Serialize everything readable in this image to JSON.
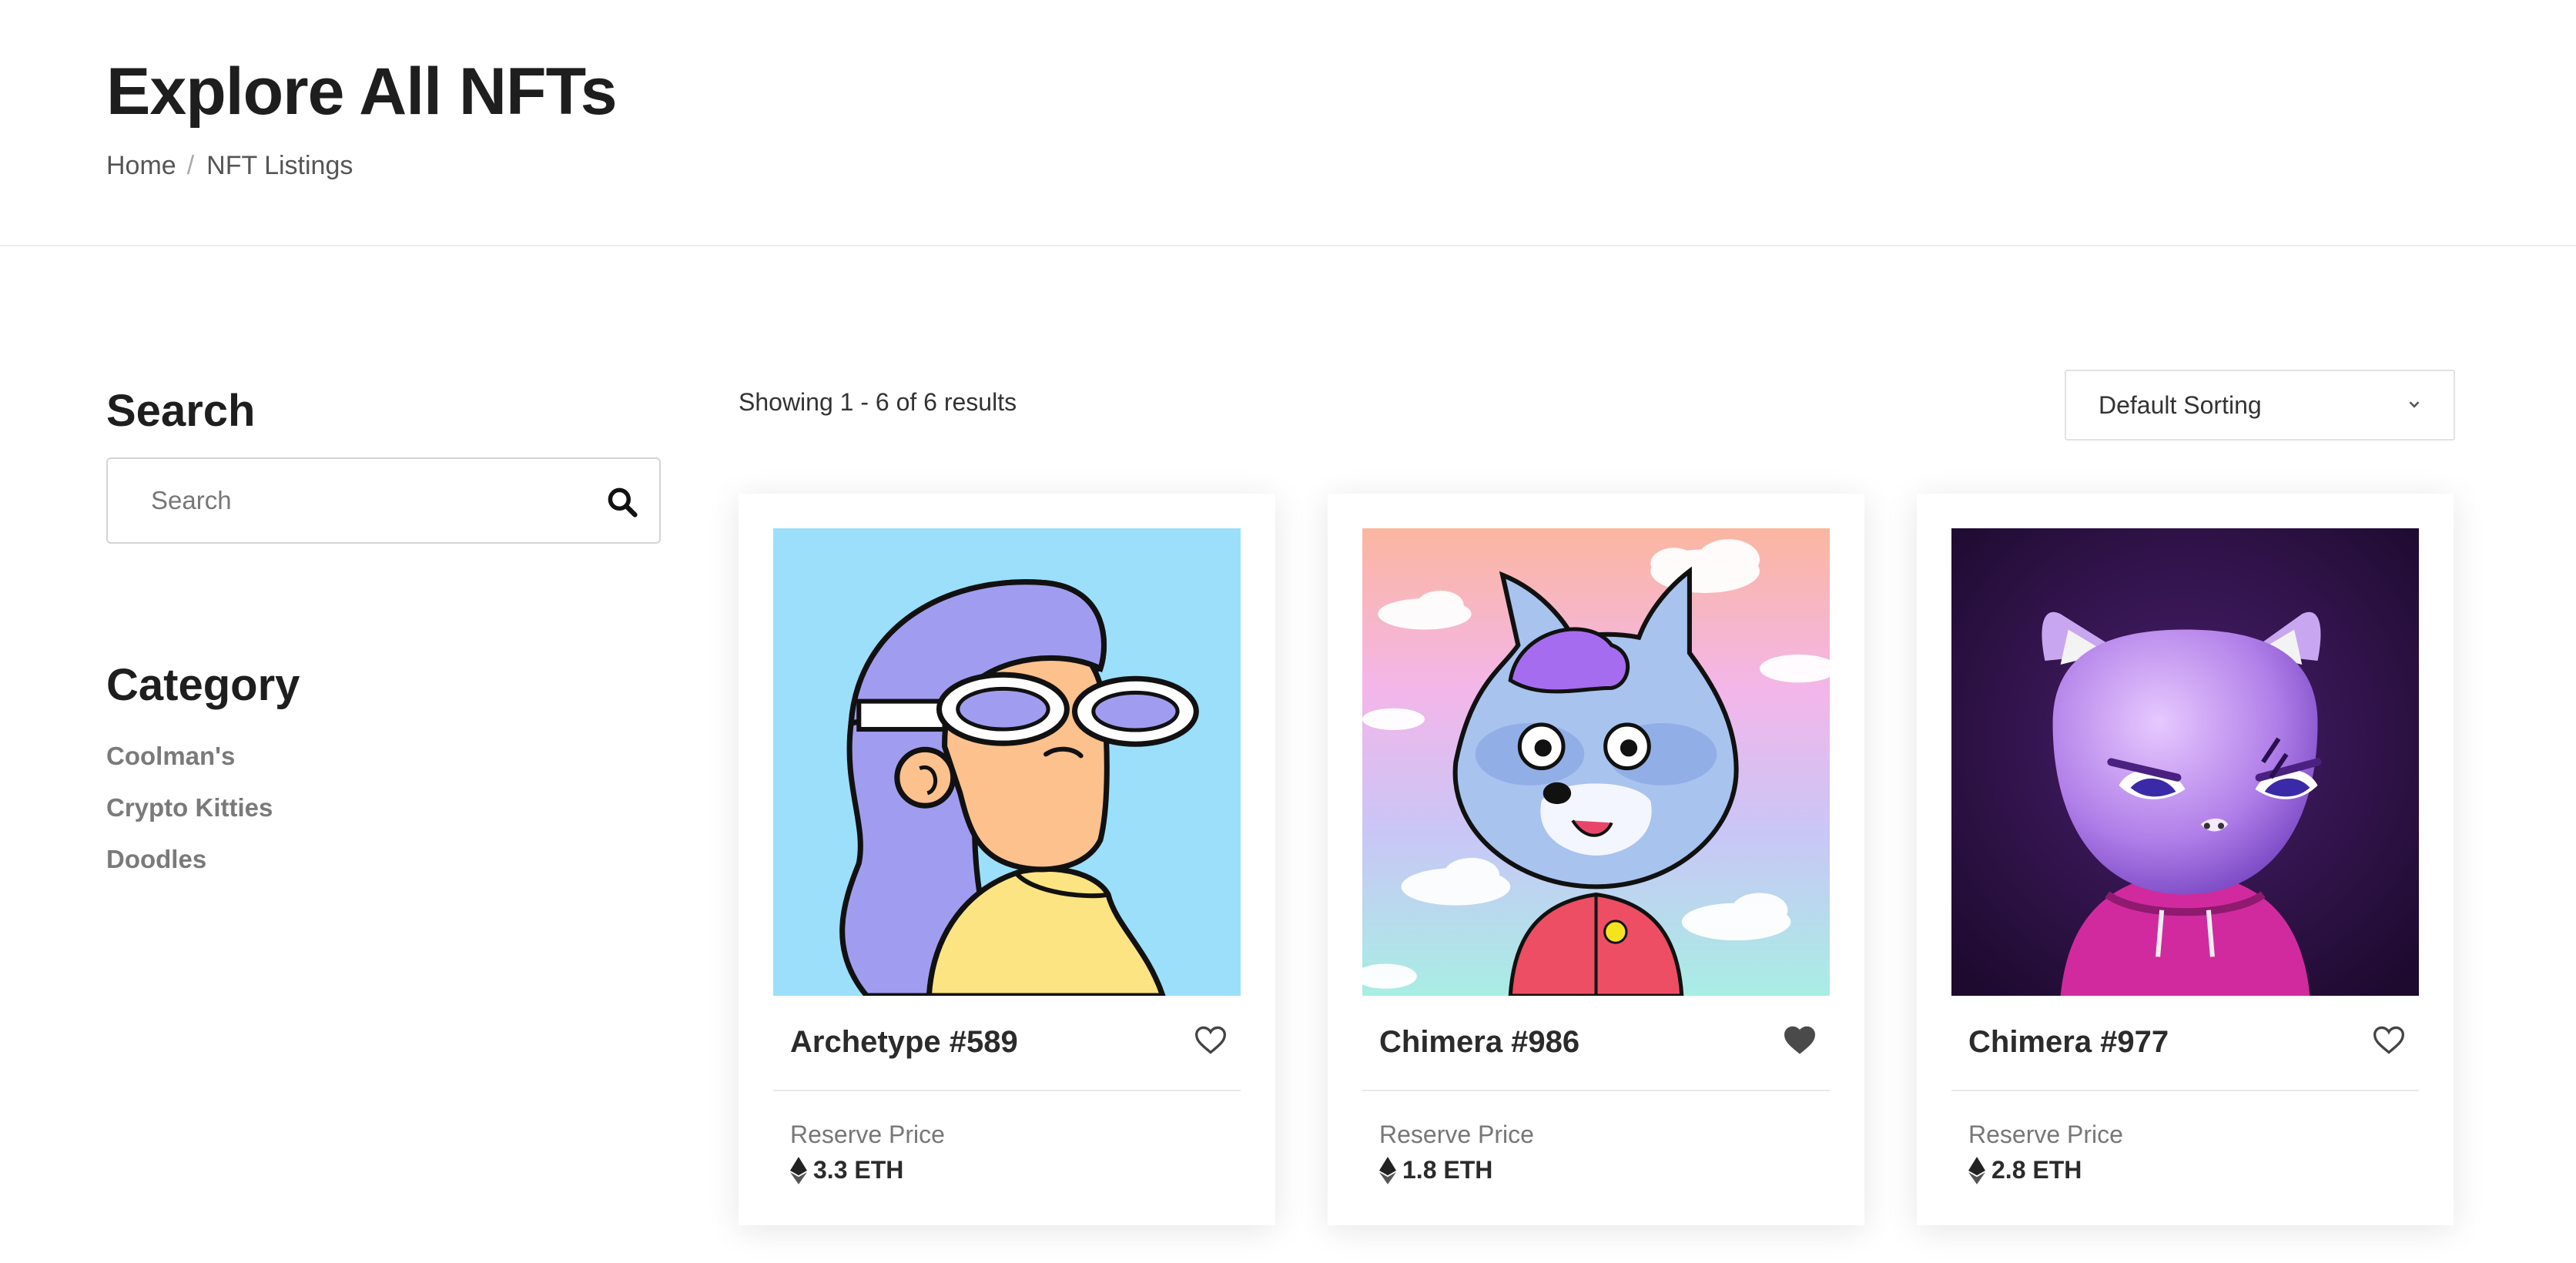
{
  "header": {
    "title": "Explore All NFTs",
    "breadcrumb": [
      {
        "label": "Home"
      },
      {
        "label": "NFT Listings"
      }
    ]
  },
  "sidebar": {
    "search_heading": "Search",
    "search": {
      "placeholder": "Search",
      "value": ""
    },
    "category_heading": "Category",
    "categories": [
      "Coolman's",
      "Crypto Kitties",
      "Doodles"
    ]
  },
  "toolbar": {
    "result_text": "Showing 1 - 6 of 6 results",
    "sort_selected": "Default Sorting"
  },
  "cards": [
    {
      "name": "Archetype #589",
      "price_label": "Reserve Price",
      "price": "3.3 ETH",
      "favorited": false,
      "image": "doodle-girl-with-goggles"
    },
    {
      "name": "Chimera #986",
      "price_label": "Reserve Price",
      "price": "1.8 ETH",
      "favorited": true,
      "image": "cartoon-wolf-red-jacket"
    },
    {
      "name": "Chimera #977",
      "price_label": "Reserve Price",
      "price": "2.8 ETH",
      "favorited": false,
      "image": "3d-purple-cat-pink-hoodie"
    }
  ],
  "colors": {
    "heading": "#1e1e1e",
    "muted_text": "#777777",
    "category_text": "#7a7a7a",
    "divider": "#e9e9e9"
  },
  "icons": {
    "search": "search-icon",
    "sort": "chevron-down-icon",
    "favorite": "heart-icon",
    "currency": "ethereum-icon"
  }
}
